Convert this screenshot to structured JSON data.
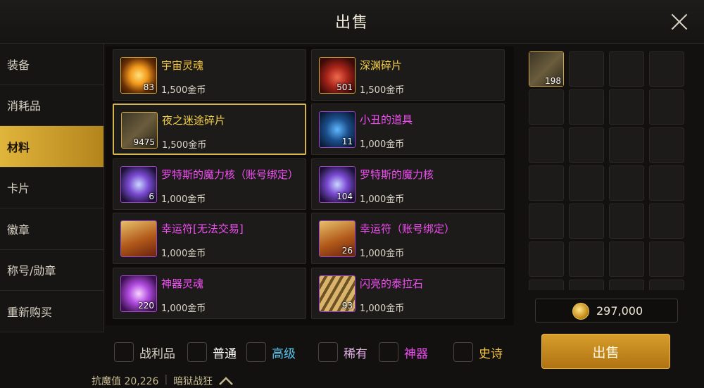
{
  "title": "出售",
  "sidebar": {
    "items": [
      {
        "label": "装备",
        "active": false
      },
      {
        "label": "消耗品",
        "active": false
      },
      {
        "label": "材料",
        "active": true
      },
      {
        "label": "卡片",
        "active": false
      },
      {
        "label": "徽章",
        "active": false
      },
      {
        "label": "称号/勋章",
        "active": false
      },
      {
        "label": "重新购买",
        "active": false
      }
    ]
  },
  "items": [
    {
      "name": "宇宙灵魂",
      "qty": "83",
      "price": "1,500金币",
      "name_color": "#f3c440",
      "icon": "golden-orb-icon"
    },
    {
      "name": "深渊碎片",
      "qty": "501",
      "price": "1,500金币",
      "name_color": "#f6d24a",
      "icon": "red-crystal-icon"
    },
    {
      "name": "夜之迷途碎片",
      "qty": "9475",
      "price": "1,500金币",
      "name_color": "#f6d24a",
      "icon": "scroll-fragment-icon",
      "selected": true
    },
    {
      "name": "小丑的道具",
      "qty": "11",
      "price": "1,000金币",
      "name_color": "#f14ef3",
      "icon": "jester-prop-icon"
    },
    {
      "name": "罗特斯的魔力核（账号绑定）",
      "qty": "6",
      "price": "1,000金币",
      "name_color": "#f14ef3",
      "icon": "magic-core-icon"
    },
    {
      "name": "罗特斯的魔力核",
      "qty": "104",
      "price": "1,000金币",
      "name_color": "#f14ef3",
      "icon": "magic-core-icon"
    },
    {
      "name": "幸运符[无法交易]",
      "qty": "",
      "price": "1,000金币",
      "name_color": "#f14ef3",
      "icon": "lucky-charm-icon"
    },
    {
      "name": "幸运符（账号绑定）",
      "qty": "26",
      "price": "1,000金币",
      "name_color": "#f14ef3",
      "icon": "lucky-charm-icon"
    },
    {
      "name": "神器灵魂",
      "qty": "220",
      "price": "1,000金币",
      "name_color": "#f14ef3",
      "icon": "artifact-soul-icon"
    },
    {
      "name": "闪亮的泰拉石",
      "qty": "93",
      "price": "1,000金币",
      "name_color": "#f14ef3",
      "icon": "tera-stone-icon"
    }
  ],
  "bag": {
    "slots": [
      {
        "qty": "198",
        "icon": "scroll-fragment-icon"
      }
    ]
  },
  "gold": "297,000",
  "filters": [
    {
      "label": "战利品",
      "color": "#d8d2c4"
    },
    {
      "label": "普通",
      "color": "#ffffff"
    },
    {
      "label": "高级",
      "color": "#58c6f0"
    },
    {
      "label": "稀有",
      "color": "#e3b3e6"
    },
    {
      "label": "神器",
      "color": "#f14ef3"
    },
    {
      "label": "史诗",
      "color": "#f3c440"
    }
  ],
  "sell_button": "出售",
  "hud": {
    "stat": "抗魔值 20,226",
    "mode": "暗狱战狂"
  }
}
